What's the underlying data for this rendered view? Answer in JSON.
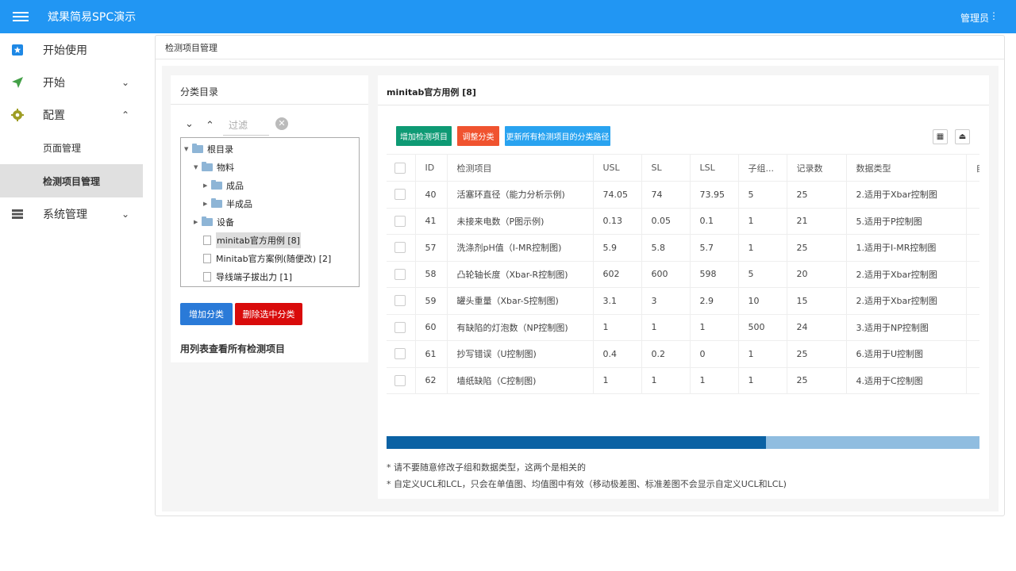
{
  "app": {
    "title": "斌果简易SPC演示",
    "user": "管理员",
    "user_menu": "⋮"
  },
  "sidebar": {
    "items": [
      {
        "label": "开始使用",
        "chevron": ""
      },
      {
        "label": "开始",
        "chevron": "⌄"
      },
      {
        "label": "配置",
        "chevron": "⌃"
      },
      {
        "label": "系统管理",
        "chevron": "⌄"
      }
    ],
    "sub_items": [
      {
        "label": "页面管理"
      },
      {
        "label": "检测项目管理"
      }
    ]
  },
  "page": {
    "title": "检测项目管理"
  },
  "category_panel": {
    "title": "分类目录",
    "filter_placeholder": "过滤",
    "clear": "✕",
    "tree": [
      {
        "label": "根目录"
      },
      {
        "label": "物料"
      },
      {
        "label": "成品"
      },
      {
        "label": "半成品"
      },
      {
        "label": "设备"
      },
      {
        "label": "minitab官方用例 [8]"
      },
      {
        "label": "Minitab官方案例(随便改) [2]"
      },
      {
        "label": "导线端子拔出力 [1]"
      }
    ],
    "add_button": "增加分类",
    "delete_button": "删除选中分类",
    "view_all_link": "用列表查看所有检测项目"
  },
  "items_panel": {
    "title": "minitab官方用例 [8]",
    "buttons": {
      "add": "增加检测项目",
      "adjust": "调整分类",
      "update": "更新所有检测项目的分类路径"
    },
    "columns": [
      "ID",
      "检测项目",
      "USL",
      "SL",
      "LSL",
      "子组...",
      "记录数",
      "数据类型",
      "自"
    ],
    "rows": [
      {
        "id": "40",
        "name": "活塞环直径（能力分析示例)",
        "usl": "74.05",
        "sl": "74",
        "lsl": "73.95",
        "sub": "5",
        "count": "25",
        "type": "2.适用于Xbar控制图"
      },
      {
        "id": "41",
        "name": "未接来电数（P图示例)",
        "usl": "0.13",
        "sl": "0.05",
        "lsl": "0.1",
        "sub": "1",
        "count": "21",
        "type": "5.适用于P控制图"
      },
      {
        "id": "57",
        "name": "洗涤剂pH值（I-MR控制图)",
        "usl": "5.9",
        "sl": "5.8",
        "lsl": "5.7",
        "sub": "1",
        "count": "25",
        "type": "1.适用于I-MR控制图"
      },
      {
        "id": "58",
        "name": "凸轮轴长度（Xbar-R控制图)",
        "usl": "602",
        "sl": "600",
        "lsl": "598",
        "sub": "5",
        "count": "20",
        "type": "2.适用于Xbar控制图"
      },
      {
        "id": "59",
        "name": "罐头重量（Xbar-S控制图)",
        "usl": "3.1",
        "sl": "3",
        "lsl": "2.9",
        "sub": "10",
        "count": "15",
        "type": "2.适用于Xbar控制图"
      },
      {
        "id": "60",
        "name": "有缺陷的灯泡数（NP控制图)",
        "usl": "1",
        "sl": "1",
        "lsl": "1",
        "sub": "500",
        "count": "24",
        "type": "3.适用于NP控制图"
      },
      {
        "id": "61",
        "name": "抄写错误（U控制图)",
        "usl": "0.4",
        "sl": "0.2",
        "lsl": "0",
        "sub": "1",
        "count": "25",
        "type": "6.适用于U控制图"
      },
      {
        "id": "62",
        "name": "墙纸缺陷（C控制图)",
        "usl": "1",
        "sl": "1",
        "lsl": "1",
        "sub": "1",
        "count": "25",
        "type": "4.适用于C控制图"
      }
    ],
    "horizontal_scroll_fraction": 0.64,
    "notes": [
      "* 请不要随意修改子组和数据类型，这两个是相关的",
      "* 自定义UCL和LCL，只会在单值图、均值图中有效（移动极差图、标准差图不会显示自定义UCL和LCL)"
    ]
  },
  "colors": {
    "topbar": "#2196f3",
    "add_item": "#0e9a74",
    "adjust": "#f0532f",
    "update": "#29a3f0",
    "add_category": "#2a7ad8",
    "delete_category": "#d90b0b",
    "scroll_thumb": "#0b62a4"
  }
}
